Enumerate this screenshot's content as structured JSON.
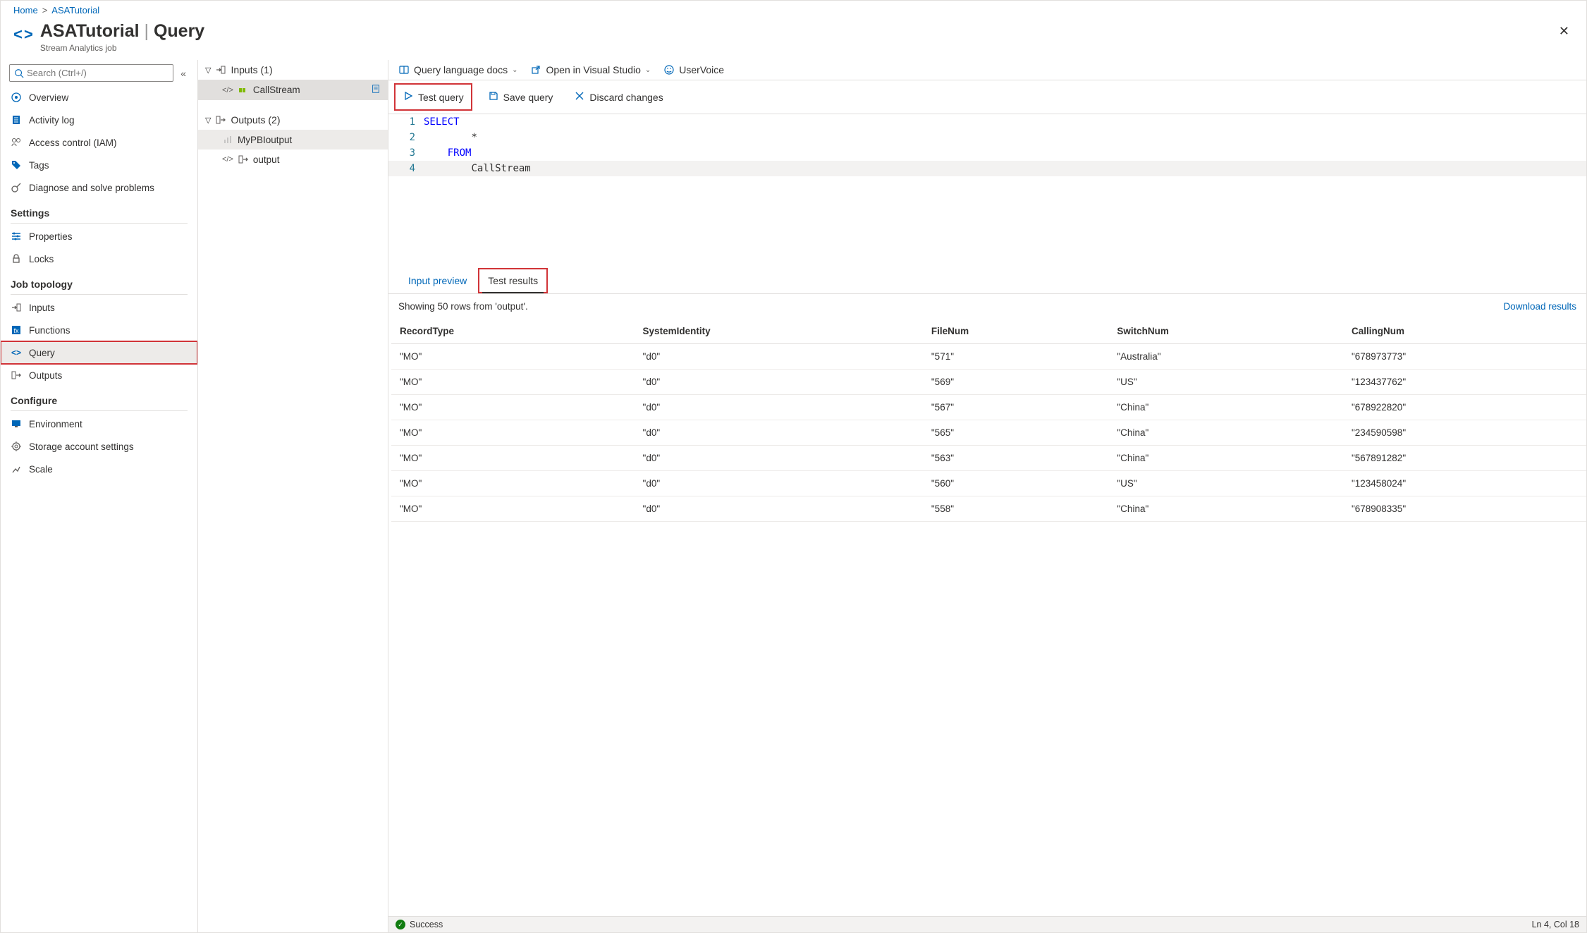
{
  "breadcrumb": {
    "home": "Home",
    "resource": "ASATutorial"
  },
  "header": {
    "title": "ASATutorial",
    "sep": " | ",
    "page": "Query",
    "subtitle": "Stream Analytics job"
  },
  "search": {
    "placeholder": "Search (Ctrl+/)"
  },
  "nav": {
    "items1": [
      {
        "label": "Overview"
      },
      {
        "label": "Activity log"
      },
      {
        "label": "Access control (IAM)"
      },
      {
        "label": "Tags"
      },
      {
        "label": "Diagnose and solve problems"
      }
    ],
    "section_settings": "Settings",
    "items_settings": [
      {
        "label": "Properties"
      },
      {
        "label": "Locks"
      }
    ],
    "section_topology": "Job topology",
    "items_topology": [
      {
        "label": "Inputs"
      },
      {
        "label": "Functions"
      },
      {
        "label": "Query"
      },
      {
        "label": "Outputs"
      }
    ],
    "section_configure": "Configure",
    "items_configure": [
      {
        "label": "Environment"
      },
      {
        "label": "Storage account settings"
      },
      {
        "label": "Scale"
      }
    ]
  },
  "mid": {
    "inputs_header": "Inputs (1)",
    "inputs": [
      {
        "label": "CallStream"
      }
    ],
    "outputs_header": "Outputs (2)",
    "outputs": [
      {
        "label": "MyPBIoutput"
      },
      {
        "label": "output"
      }
    ]
  },
  "cmdbar": {
    "docs": "Query language docs",
    "vs": "Open in Visual Studio",
    "uv": "UserVoice"
  },
  "cmdbar2": {
    "test": "Test query",
    "save": "Save query",
    "discard": "Discard changes"
  },
  "editor": {
    "lines": [
      {
        "n": "1",
        "text": "SELECT",
        "cls": "kw",
        "indent": ""
      },
      {
        "n": "2",
        "text": "*",
        "cls": "star",
        "indent": "        "
      },
      {
        "n": "3",
        "text": "FROM",
        "cls": "kw",
        "indent": "    "
      },
      {
        "n": "4",
        "text": "CallStream",
        "cls": "ident",
        "indent": "        "
      }
    ]
  },
  "tabs": {
    "preview": "Input preview",
    "results": "Test results"
  },
  "results": {
    "summary": "Showing 50 rows from 'output'.",
    "download": "Download results",
    "columns": [
      "RecordType",
      "SystemIdentity",
      "FileNum",
      "SwitchNum",
      "CallingNum"
    ],
    "rows": [
      [
        "\"MO\"",
        "\"d0\"",
        "\"571\"",
        "\"Australia\"",
        "\"678973773\""
      ],
      [
        "\"MO\"",
        "\"d0\"",
        "\"569\"",
        "\"US\"",
        "\"123437762\""
      ],
      [
        "\"MO\"",
        "\"d0\"",
        "\"567\"",
        "\"China\"",
        "\"678922820\""
      ],
      [
        "\"MO\"",
        "\"d0\"",
        "\"565\"",
        "\"China\"",
        "\"234590598\""
      ],
      [
        "\"MO\"",
        "\"d0\"",
        "\"563\"",
        "\"China\"",
        "\"567891282\""
      ],
      [
        "\"MO\"",
        "\"d0\"",
        "\"560\"",
        "\"US\"",
        "\"123458024\""
      ],
      [
        "\"MO\"",
        "\"d0\"",
        "\"558\"",
        "\"China\"",
        "\"678908335\""
      ]
    ]
  },
  "status": {
    "text": "Success",
    "cursor": "Ln 4, Col 18"
  }
}
